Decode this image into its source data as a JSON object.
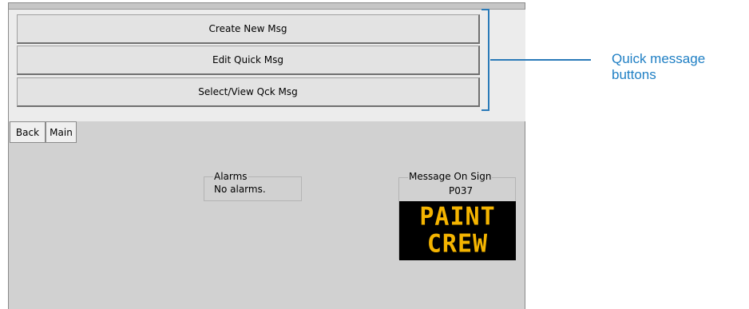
{
  "quick_buttons": {
    "create": "Create New Msg",
    "edit": "Edit Quick Msg",
    "select_view": "Select/View Qck Msg"
  },
  "nav": {
    "back": "Back",
    "main": "Main"
  },
  "alarms": {
    "label": "Alarms",
    "status": "No alarms."
  },
  "sign": {
    "label": "Message On Sign",
    "code": "P037",
    "line1": "PAINT",
    "line2": "CREW",
    "text_color": "#f4b400",
    "background_color": "#000000"
  },
  "annotation": {
    "line1": "Quick message",
    "line2": "buttons",
    "color": "#1f7fc4"
  }
}
